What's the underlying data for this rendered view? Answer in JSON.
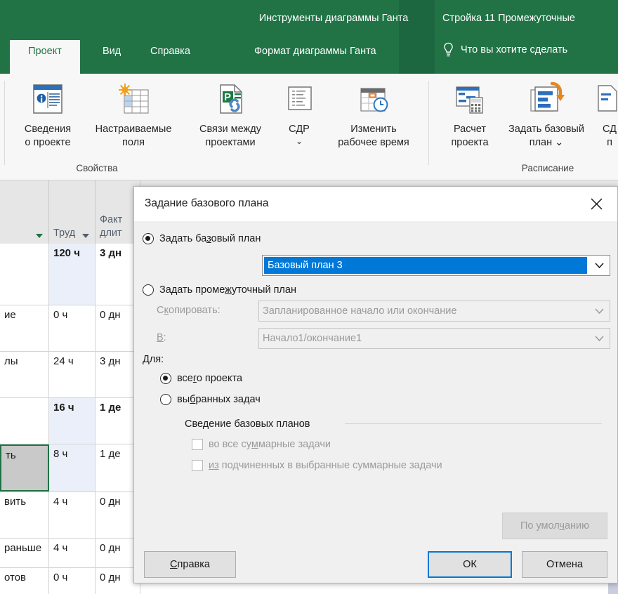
{
  "ribbon": {
    "context_tab_group": "Инструменты диаграммы Ганта",
    "window_title": "Стройка 11 Промежуточные",
    "tabs": [
      {
        "label": "Проект",
        "active": true
      },
      {
        "label": "Вид",
        "active": false
      },
      {
        "label": "Справка",
        "active": false
      },
      {
        "label": "Формат диаграммы Ганта",
        "active": false
      }
    ],
    "tell_me": "Что вы хотите сделать",
    "tell_me_icon": "lightbulb-icon",
    "groups": [
      {
        "label": "Свойства"
      },
      {
        "label": "Расписание"
      }
    ],
    "buttons": [
      {
        "icon": "project-information-icon",
        "label": "Сведения\nо проекте"
      },
      {
        "icon": "custom-fields-icon",
        "label": "Настраиваемые\nполя"
      },
      {
        "icon": "links-between-projects-icon",
        "label": "Связи между\nпроектами"
      },
      {
        "icon": "wbs-icon",
        "label": "СДР",
        "caret": "⌄"
      },
      {
        "icon": "change-working-time-icon",
        "label": "Изменить\nрабочее время"
      },
      {
        "icon": "calculate-project-icon",
        "label": "Расчет\nпроекта"
      },
      {
        "icon": "set-baseline-icon",
        "label": "Задать базовый\nплан ⌄"
      },
      {
        "icon": "move-project-icon",
        "label": "СД\nп"
      }
    ]
  },
  "sheet": {
    "headers": [
      {
        "label": "",
        "arrow": true
      },
      {
        "label": "Труд",
        "arrow": true
      },
      {
        "label": "Факт\nдлит",
        "arrow": false
      }
    ],
    "rows": [
      {
        "name": "",
        "trud": "120 ч",
        "fakt": "3 дн",
        "bold": true,
        "highlight": true,
        "selected": false
      },
      {
        "name": "ие",
        "trud": "0 ч",
        "fakt": "0 дн",
        "bold": false,
        "highlight": false,
        "selected": false
      },
      {
        "name": "лы",
        "trud": "24 ч",
        "fakt": "3 дн",
        "bold": false,
        "highlight": false,
        "selected": false
      },
      {
        "name": "",
        "trud": "16 ч",
        "fakt": "1 де",
        "bold": true,
        "highlight": true,
        "selected": false
      },
      {
        "name": "ть",
        "trud": "8 ч",
        "fakt": "1 де",
        "bold": false,
        "highlight": true,
        "selected": true
      },
      {
        "name": "вить",
        "trud": "4 ч",
        "fakt": "0 дн",
        "bold": false,
        "highlight": false,
        "selected": false
      },
      {
        "name": "раньше",
        "trud": "4 ч",
        "fakt": "0 дн",
        "bold": false,
        "highlight": false,
        "selected": false
      },
      {
        "name": "отов",
        "trud": "0 ч",
        "fakt": "0 дн",
        "bold": false,
        "highlight": false,
        "selected": false
      }
    ]
  },
  "dialog": {
    "title": "Задание базового плана",
    "close_icon": "close-icon",
    "radio_baseline": {
      "label_pre": "Задать ба",
      "label_u": "з",
      "label_post": "овый план",
      "checked": true
    },
    "baseline_combo": {
      "value": "Базовый план 3",
      "selected": true,
      "arrow_icon": "chevron-down-icon"
    },
    "radio_interim": {
      "label_pre": "Задать проме",
      "label_u": "ж",
      "label_post": "уточный план",
      "checked": false
    },
    "copy_label": {
      "pre": "С",
      "u": "к",
      "post": "опировать:"
    },
    "copy_combo": {
      "value": "Запланированное начало или окончание",
      "disabled": true,
      "arrow_icon": "chevron-down-icon"
    },
    "into_label": {
      "pre": "",
      "u": "В",
      "post": ":"
    },
    "into_combo": {
      "value": "Начало1/окончание1",
      "disabled": true,
      "arrow_icon": "chevron-down-icon"
    },
    "for_label": "Для:",
    "radio_whole": {
      "label_pre": "все",
      "label_u": "г",
      "label_post": "о проекта",
      "checked": true
    },
    "radio_selected": {
      "label_pre": "вы",
      "label_u": "б",
      "label_post": "ранных задач",
      "checked": false
    },
    "rollup_group": "Сведение базовых планов",
    "chk_all_summary": {
      "pre": "во все су",
      "u": "м",
      "post": "марные задачи",
      "checked": false
    },
    "chk_from_sub": {
      "pre": "",
      "u": "из",
      "post": " подчиненных в выбранные суммарные задачи",
      "checked": false
    },
    "btn_default": {
      "pre": "По умол",
      "u": "ч",
      "post": "анию",
      "disabled": true
    },
    "btn_help": {
      "pre": "",
      "u": "С",
      "post": "правка"
    },
    "btn_ok": "ОК",
    "btn_cancel": "Отмена"
  },
  "colors": {
    "ribbon_green": "#217346",
    "context_green": "#1e6b41",
    "accent_blue": "#0078d7",
    "selection_green": "#1f7244",
    "highlight_cell": "#eaeff9"
  }
}
